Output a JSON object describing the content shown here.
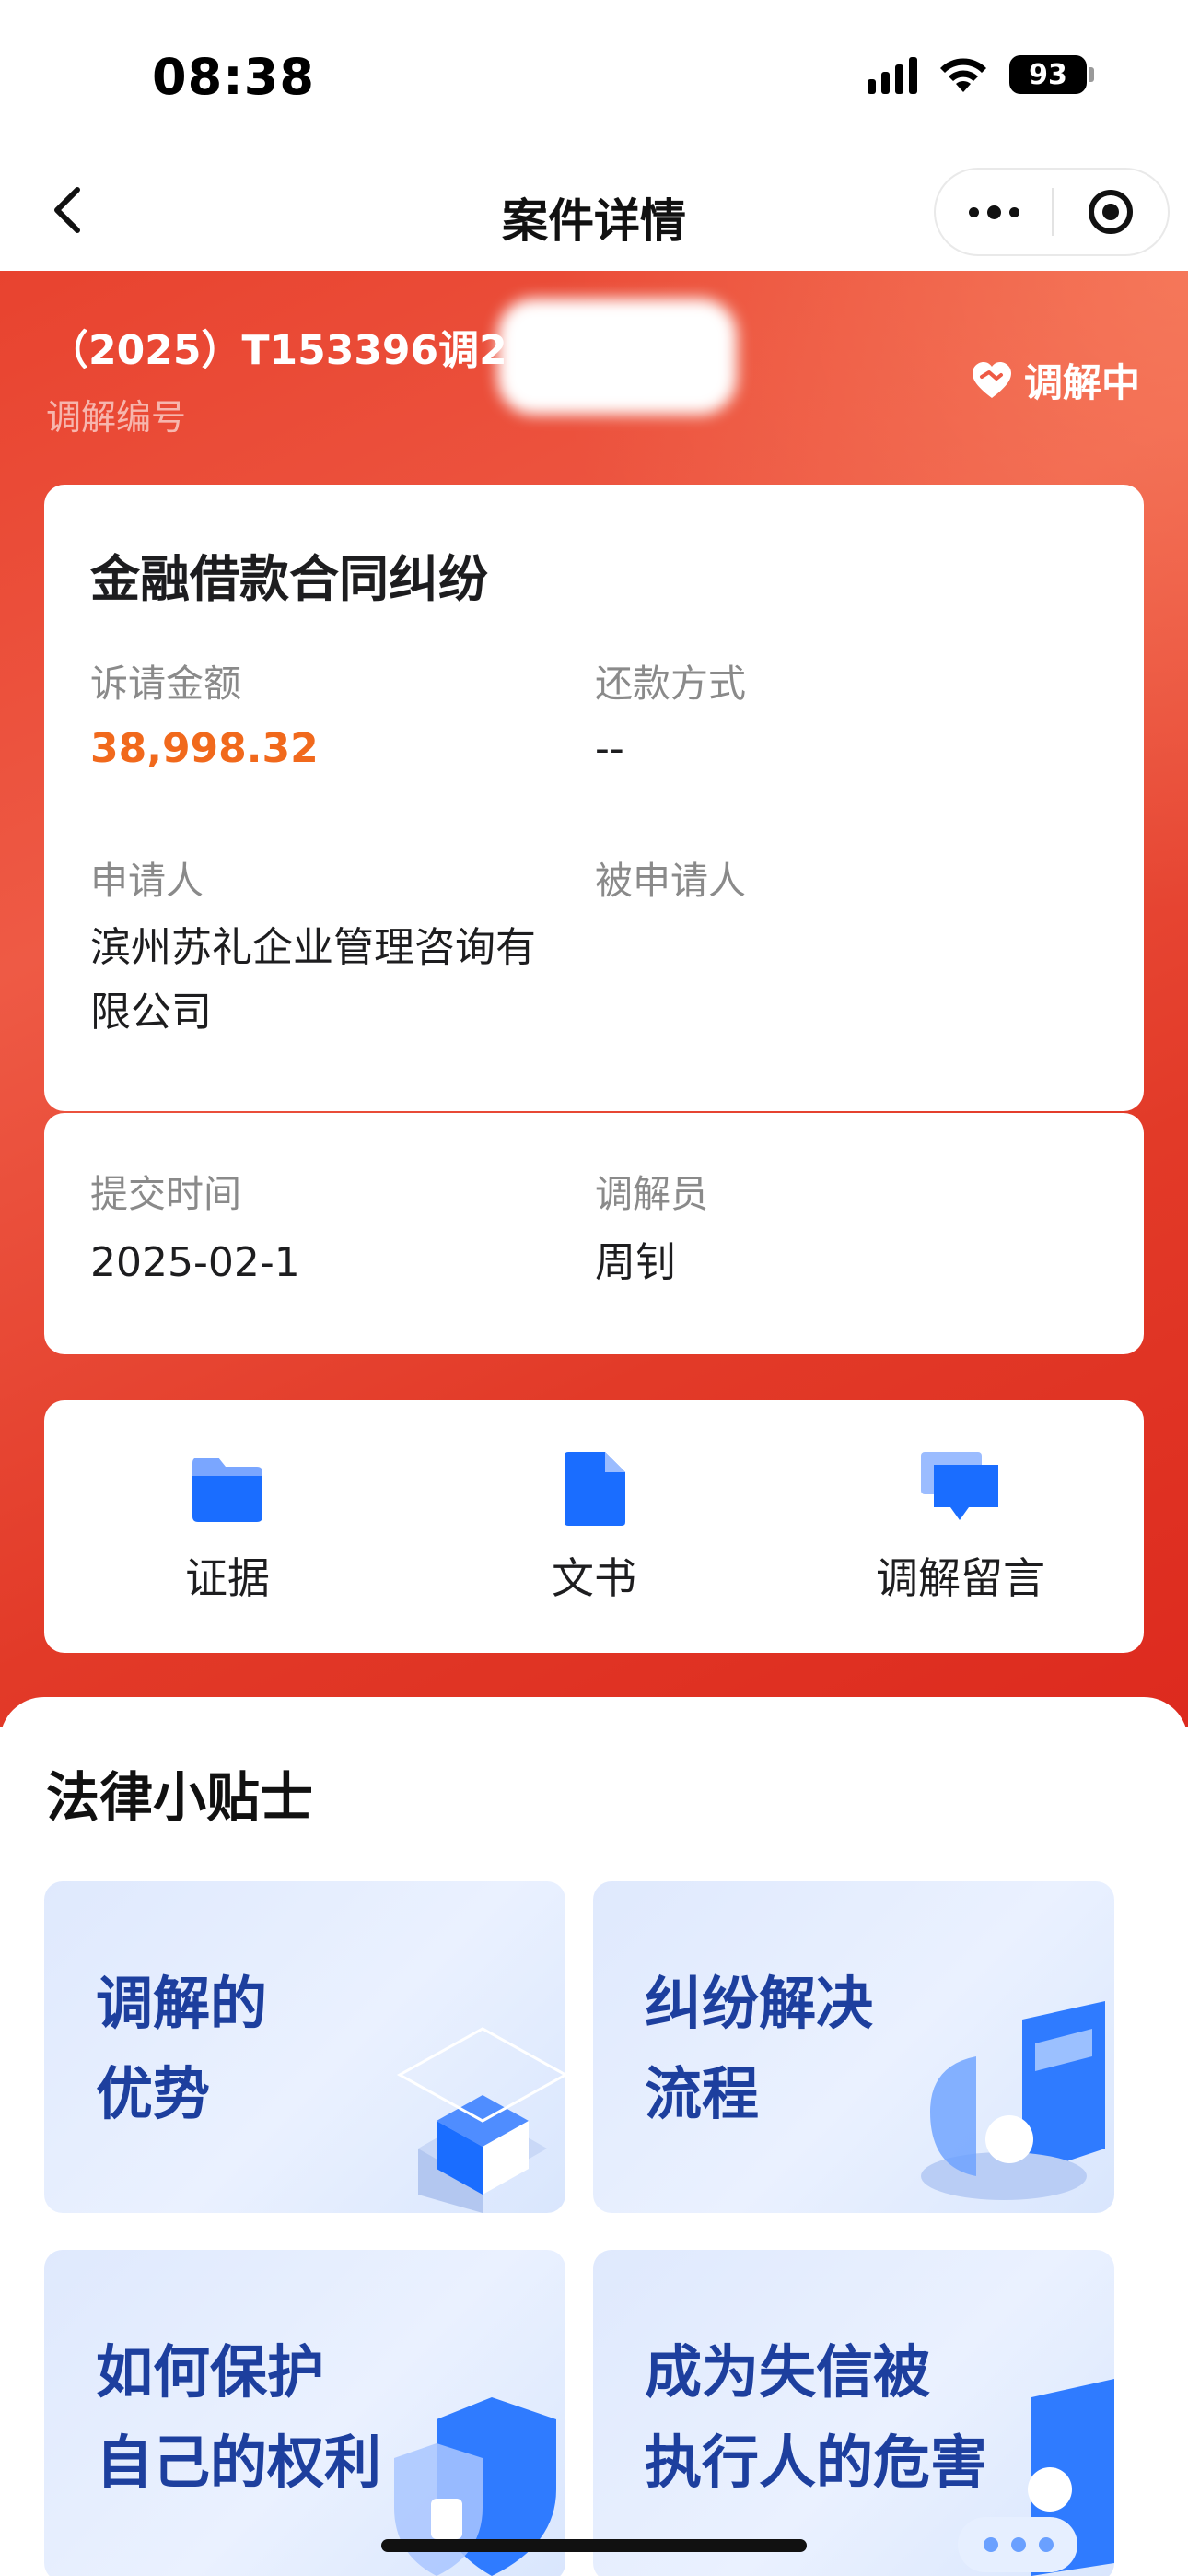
{
  "status_bar": {
    "time": "08:38",
    "battery": "93"
  },
  "nav": {
    "title": "案件详情"
  },
  "case": {
    "number": "（2025）T153396调2",
    "number_label": "调解编号",
    "status": "调解中",
    "type": "金融借款合同纠纷",
    "amount_label": "诉请金额",
    "amount": "38,998.32",
    "repay_label": "还款方式",
    "repay_value": "--",
    "applicant_label": "申请人",
    "applicant": "滨州苏礼企业管理咨询有\n限公司",
    "respondent_label": "被申请人",
    "submit_label": "提交时间",
    "submit_time": "2025-02-1",
    "mediator_label": "调解员",
    "mediator": "周钊"
  },
  "actions": [
    {
      "label": "证据",
      "icon": "folder-icon"
    },
    {
      "label": "文书",
      "icon": "document-icon"
    },
    {
      "label": "调解留言",
      "icon": "message-icon"
    }
  ],
  "tips": {
    "title": "法律小贴士",
    "items": [
      {
        "text": "调解的\n优势"
      },
      {
        "text": "纠纷解决\n流程"
      },
      {
        "text": "如何保护\n自己的权利"
      },
      {
        "text": "成为失信被\n执行人的危害"
      }
    ]
  },
  "colors": {
    "primary_red": "#e8432f",
    "amount_orange": "#f1691c",
    "icon_blue": "#1a6dff",
    "tip_text": "#1d3f9e"
  }
}
